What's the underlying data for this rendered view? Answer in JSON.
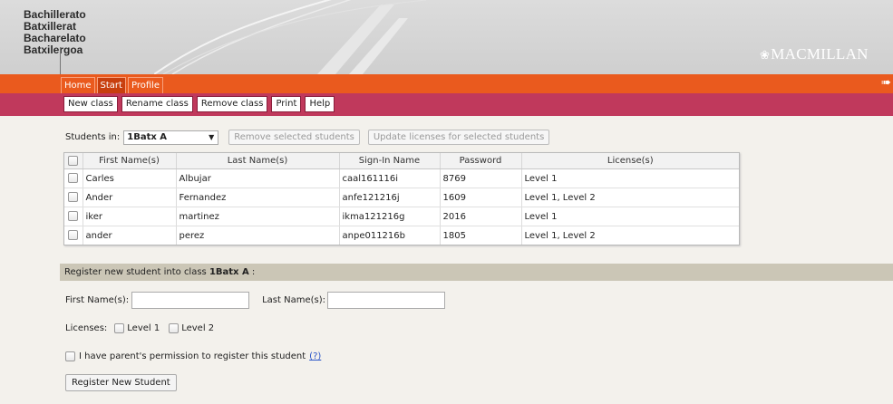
{
  "brand": {
    "lines": [
      "Bachillerato",
      "Batxillerat",
      "Bacharelato",
      "Batxilergoa"
    ],
    "logo_text": "MACMILLAN"
  },
  "nav": {
    "tabs": [
      {
        "label": "Home",
        "active": false
      },
      {
        "label": "Start",
        "active": true
      },
      {
        "label": "Profile",
        "active": false
      }
    ]
  },
  "toolbar": {
    "buttons": [
      "New class",
      "Rename class",
      "Remove class",
      "Print",
      "Help"
    ]
  },
  "students": {
    "label": "Students in:",
    "selected_class": "1Batx A",
    "remove_button": "Remove selected students",
    "update_button": "Update licenses for selected students",
    "columns": [
      "First Name(s)",
      "Last Name(s)",
      "Sign-In Name",
      "Password",
      "License(s)"
    ],
    "rows": [
      [
        "Carles",
        "Albujar",
        "caal161116i",
        "8769",
        "Level 1"
      ],
      [
        "Ander",
        "Fernandez",
        "anfe121216j",
        "1609",
        "Level 1, Level 2"
      ],
      [
        "iker",
        "martinez",
        "ikma121216g",
        "2016",
        "Level 1"
      ],
      [
        "ander",
        "perez",
        "anpe011216b",
        "1805",
        "Level 1, Level 2"
      ]
    ]
  },
  "register": {
    "bar_text": "Register new student into class",
    "class_name": "1Batx A",
    "bar_suffix": ":",
    "first_name_label": "First Name(s):",
    "last_name_label": "Last Name(s):",
    "first_name_value": "",
    "last_name_value": "",
    "licenses_label": "Licenses:",
    "license_options": [
      "Level 1",
      "Level 2"
    ],
    "permission_text": "I have parent's permission to register this student",
    "help_link": "(?)",
    "submit_label": "Register New Student"
  },
  "colors": {
    "nav_orange": "#ea5a1e",
    "toolbar_magenta": "#c0395c",
    "register_bar": "#cbc6b6"
  }
}
